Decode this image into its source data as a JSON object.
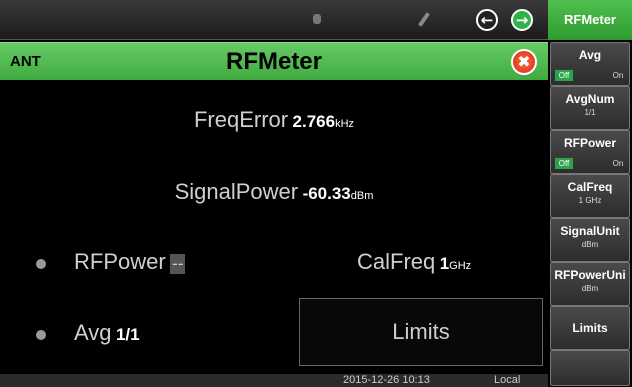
{
  "header": {
    "usb_icon": "usb-icon",
    "pen_icon": "pen-icon",
    "back_glyph": "←",
    "forward_glyph": "→"
  },
  "titlebar": {
    "port": "ANT",
    "title": "RFMeter",
    "close_glyph": "✖"
  },
  "measurements": {
    "freq_error_label": "FreqError",
    "freq_error_value": "2.766",
    "freq_error_unit": "kHz",
    "signal_power_label": "SignalPower",
    "signal_power_value": "-60.33",
    "signal_power_unit": "dBm",
    "rf_power_label": "RFPower",
    "rf_power_value": "--",
    "cal_freq_label": "CalFreq",
    "cal_freq_value": "1",
    "cal_freq_unit": "GHz",
    "avg_label": "Avg",
    "avg_value": "1/1",
    "limits_label": "Limits"
  },
  "status": {
    "datetime": "2015-12-26 10:13",
    "mode": "Local"
  },
  "menu": {
    "title": "RFMeter",
    "keys": [
      {
        "label": "Avg",
        "off": "Off",
        "on": "On"
      },
      {
        "label": "AvgNum",
        "sub": "1/1"
      },
      {
        "label": "RFPower",
        "off": "Off",
        "on": "On"
      },
      {
        "label": "CalFreq",
        "sub": "1 GHz"
      },
      {
        "label": "SignalUnit",
        "sub": "dBm"
      },
      {
        "label": "RFPowerUni",
        "sub": "dBm"
      },
      {
        "label": "Limits"
      }
    ]
  },
  "colors": {
    "accent_green": "#3faa3f",
    "toggle_active": "#2ea44a",
    "close_red": "#d62a10"
  }
}
